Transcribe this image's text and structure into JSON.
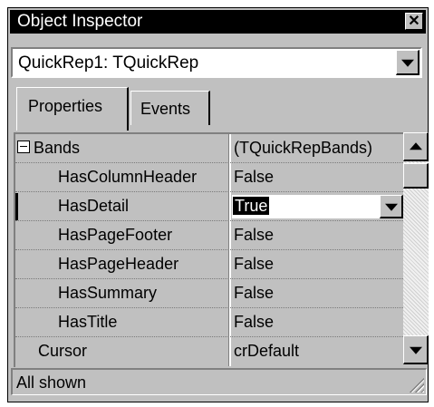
{
  "window": {
    "title": "Object Inspector",
    "close_glyph": "✕"
  },
  "object_selector": {
    "value": "QuickRep1: TQuickRep"
  },
  "tabs": [
    {
      "label": "Properties"
    },
    {
      "label": "Events"
    }
  ],
  "properties": [
    {
      "name": "Bands",
      "value": "(TQuickRepBands)"
    },
    {
      "name": "HasColumnHeader",
      "value": "False"
    },
    {
      "name": "HasDetail",
      "value": "True"
    },
    {
      "name": "HasPageFooter",
      "value": "False"
    },
    {
      "name": "HasPageHeader",
      "value": "False"
    },
    {
      "name": "HasSummary",
      "value": "False"
    },
    {
      "name": "HasTitle",
      "value": "False"
    },
    {
      "name": "Cursor",
      "value": "crDefault"
    }
  ],
  "status": {
    "text": "All shown"
  }
}
